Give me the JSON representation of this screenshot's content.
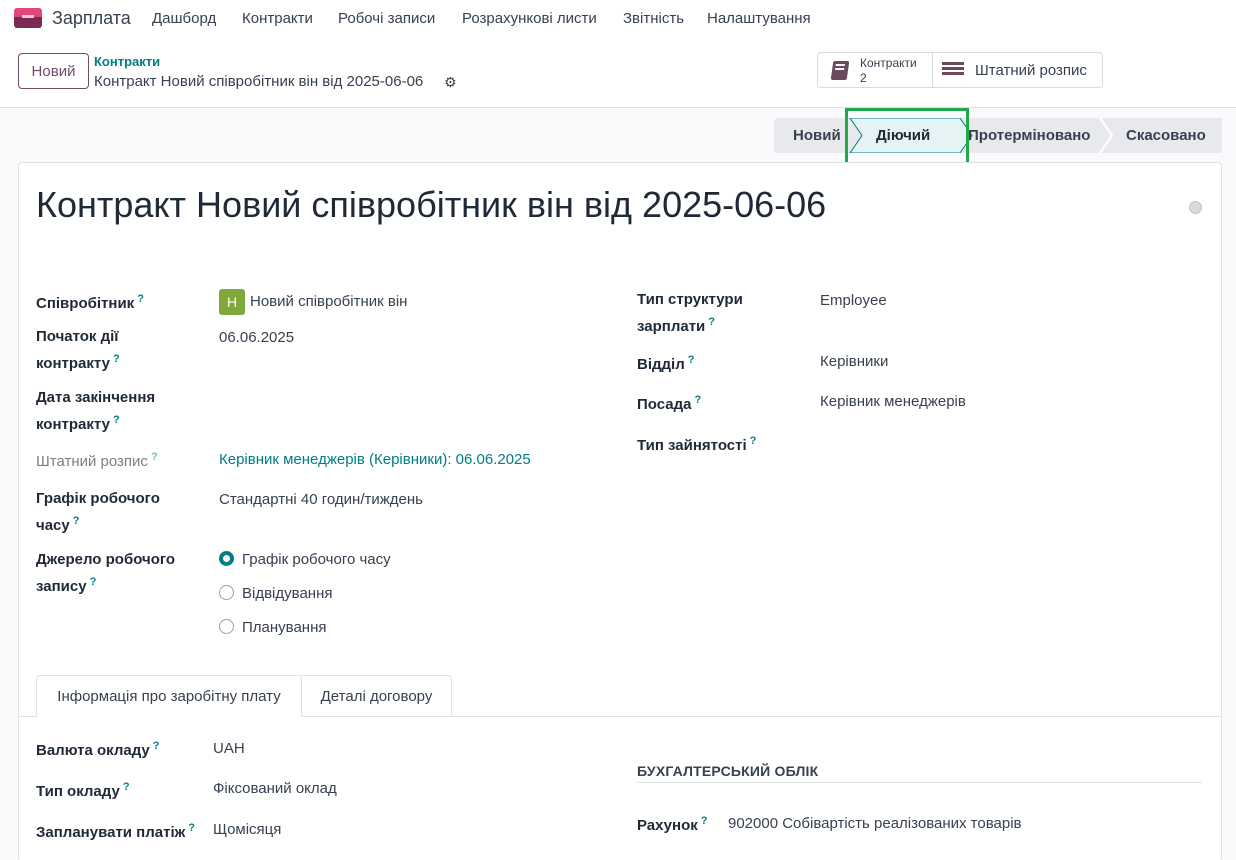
{
  "navbar": {
    "app_name": "Зарплата",
    "items": [
      "Дашборд",
      "Контракти",
      "Робочі записи",
      "Розрахункові листи",
      "Звітність",
      "Налаштування"
    ]
  },
  "control_panel": {
    "new_button": "Новий",
    "breadcrumb_parent": "Контракти",
    "breadcrumb_current": "Контракт Новий співробітник він від 2025-06-06",
    "smart_contracts_label": "Контракти",
    "smart_contracts_count": "2",
    "smart_staff_label": "Штатний розпис"
  },
  "statusbar": {
    "stages": [
      "Новий",
      "Діючий",
      "Протерміновано",
      "Скасовано"
    ],
    "active": "Діючий",
    "highlight_color": "#21a84a"
  },
  "form": {
    "title": "Контракт Новий співробітник він від 2025-06-06",
    "left": {
      "employee_label": "Співробітник",
      "employee_avatar": "Н",
      "employee_value": "Новий співробітник він",
      "start_label_1": "Початок дії",
      "start_label_2": "контракту",
      "start_value": "06.06.2025",
      "end_label_1": "Дата закінчення",
      "end_label_2": "контракту",
      "staff_label": "Штатний розпис",
      "staff_value": "Керівник менеджерів (Керівники): 06.06.2025",
      "schedule_label_1": "Графік робочого",
      "schedule_label_2": "часу",
      "schedule_value": "Стандартні 40 годин/тиждень",
      "source_label_1": "Джерело робочого",
      "source_label_2": "запису",
      "source_options": [
        "Графік робочого часу",
        "Відвідування",
        "Планування"
      ],
      "source_selected": "Графік робочого часу"
    },
    "right": {
      "structure_label_1": "Тип структури",
      "structure_label_2": "зарплати",
      "structure_value": "Employee",
      "department_label": "Відділ",
      "department_value": "Керівники",
      "job_label": "Посада",
      "job_value": "Керівник менеджерів",
      "employment_label": "Тип зайнятості"
    },
    "help_mark": "?"
  },
  "tabs": [
    "Інформація про заробітну плату",
    "Деталі договору"
  ],
  "salary": {
    "currency_label": "Валюта окладу",
    "currency_value": "UAH",
    "wage_type_label": "Тип окладу",
    "wage_type_value": "Фіксований оклад",
    "schedule_pay_label": "Запланувати платіж",
    "schedule_pay_value": "Щомісяця",
    "accounting_title": "БУХГАЛТЕРСЬКИЙ ОБЛІК",
    "account_label": "Рахунок",
    "account_value": "902000 Собівартість реалізованих товарів"
  },
  "colors": {
    "brand": "#714b67",
    "accent": "#017e84"
  }
}
